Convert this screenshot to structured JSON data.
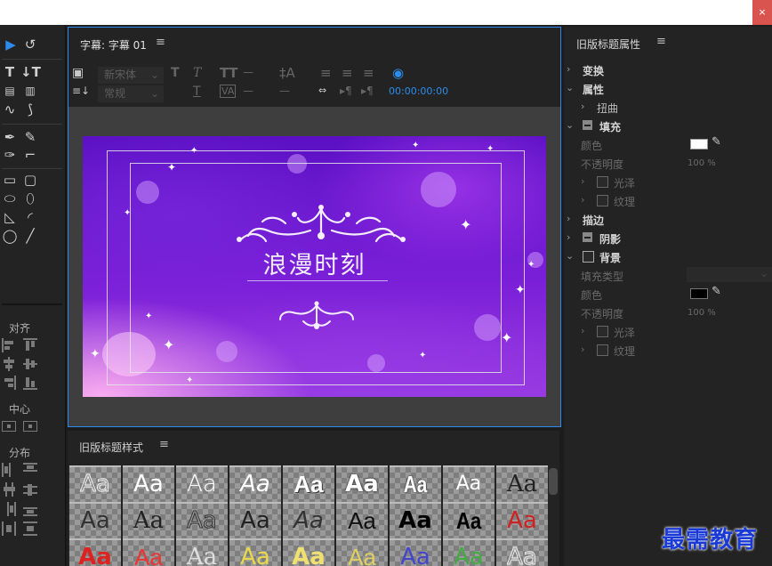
{
  "window": {
    "close_icon": "×"
  },
  "tools": {
    "align_label": "对齐",
    "center_label": "中心",
    "distribute_label": "分布",
    "icons": [
      "selection-tool",
      "rotation-tool",
      "type-tool",
      "vertical-type-tool",
      "area-type-tool",
      "vertical-area-type-tool",
      "path-type-tool",
      "vertical-path-type-tool",
      "pen-tool",
      "delete-anchor-tool",
      "add-anchor-tool",
      "convert-anchor-tool",
      "rectangle-tool",
      "rounded-rectangle-tool",
      "clipped-corner-tool",
      "rounded-corner-tool",
      "wedge-tool",
      "arc-tool",
      "ellipse-tool",
      "line-tool"
    ]
  },
  "title_panel": {
    "header": "字幕: 字幕 01",
    "menu_icon": "≡",
    "font_family": "新宋体",
    "font_style": "常规",
    "timecode": "00:00:00:00",
    "title_text": "浪漫时刻"
  },
  "styles_panel": {
    "header": "旧版标题样式",
    "menu_icon": "≡",
    "swatch_text": "Aa"
  },
  "properties_panel": {
    "header": "旧版标题属性",
    "menu_icon": "≡",
    "transform": "变换",
    "properties": "属性",
    "distort": "扭曲",
    "fill": "填充",
    "fill_color_label": "颜色",
    "fill_color": "#ffffff",
    "fill_opacity_label": "不透明度",
    "fill_opacity": "100 %",
    "sheen": "光泽",
    "texture": "纹理",
    "stroke": "描边",
    "shadow": "阴影",
    "background": "背景",
    "bg_fill_type_label": "填充类型",
    "bg_color_label": "颜色",
    "bg_color": "#000000",
    "bg_opacity_label": "不透明度",
    "bg_opacity": "100 %",
    "bg_sheen": "光泽",
    "bg_texture": "纹理"
  },
  "watermark": "最需教育"
}
